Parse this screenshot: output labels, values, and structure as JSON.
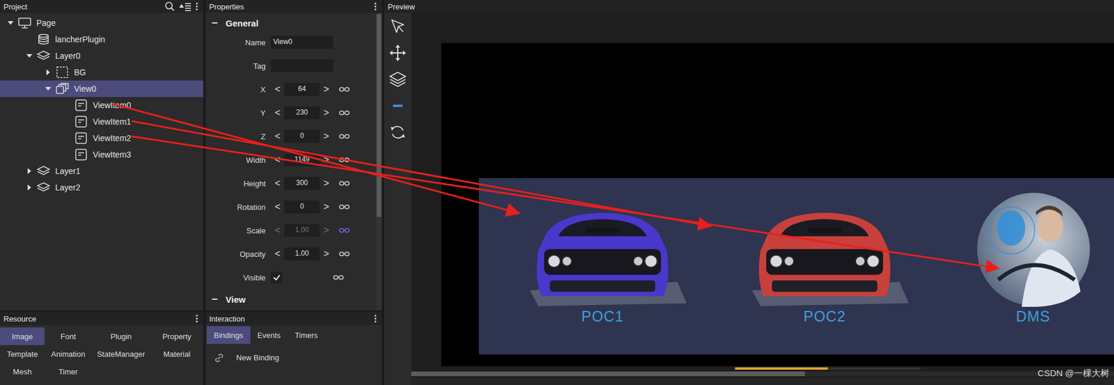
{
  "project": {
    "title": "Project",
    "tree": [
      {
        "label": "Page",
        "kind": "page",
        "expandable": true,
        "expanded": true,
        "selected": false,
        "children": [
          {
            "label": "lancherPlugin",
            "kind": "plugin",
            "expandable": false,
            "expanded": false,
            "selected": false
          },
          {
            "label": "Layer0",
            "kind": "layer",
            "expandable": true,
            "expanded": true,
            "selected": false,
            "children": [
              {
                "label": "BG",
                "kind": "group",
                "expandable": true,
                "expanded": false,
                "selected": false
              },
              {
                "label": "View0",
                "kind": "view",
                "expandable": true,
                "expanded": true,
                "selected": true,
                "children": [
                  {
                    "label": "ViewItem0",
                    "kind": "item",
                    "expandable": false,
                    "expanded": false,
                    "selected": false
                  },
                  {
                    "label": "ViewItem1",
                    "kind": "item",
                    "expandable": false,
                    "expanded": false,
                    "selected": false
                  },
                  {
                    "label": "ViewItem2",
                    "kind": "item",
                    "expandable": false,
                    "expanded": false,
                    "selected": false
                  },
                  {
                    "label": "ViewItem3",
                    "kind": "item",
                    "expandable": false,
                    "expanded": false,
                    "selected": false
                  }
                ]
              }
            ]
          },
          {
            "label": "Layer1",
            "kind": "layer",
            "expandable": true,
            "expanded": false,
            "selected": false
          },
          {
            "label": "Layer2",
            "kind": "layer",
            "expandable": true,
            "expanded": false,
            "selected": false
          }
        ]
      }
    ]
  },
  "resource": {
    "title": "Resource",
    "tabs": [
      {
        "label": "Image",
        "selected": true
      },
      {
        "label": "Font",
        "selected": false
      },
      {
        "label": "Plugin",
        "selected": false
      },
      {
        "label": "Property",
        "selected": false
      },
      {
        "label": "Template",
        "selected": false
      },
      {
        "label": "Animation",
        "selected": false
      },
      {
        "label": "StateManager",
        "selected": false
      },
      {
        "label": "Material",
        "selected": false
      },
      {
        "label": "Mesh",
        "selected": false
      },
      {
        "label": "Timer",
        "selected": false
      }
    ]
  },
  "properties": {
    "title": "Properties",
    "decrement": "<",
    "increment": ">",
    "sections": [
      {
        "title": "General",
        "toggle": "−",
        "expanded": true,
        "fields": [
          {
            "label": "Name",
            "kind": "text",
            "value": "View0"
          },
          {
            "label": "Tag",
            "kind": "text",
            "value": ""
          },
          {
            "label": "X",
            "kind": "number",
            "value": "64",
            "disabled": false,
            "linked": false
          },
          {
            "label": "Y",
            "kind": "number",
            "value": "230",
            "disabled": false,
            "linked": false
          },
          {
            "label": "Z",
            "kind": "number",
            "value": "0",
            "disabled": false,
            "linked": false
          },
          {
            "label": "Width",
            "kind": "number",
            "value": "1149",
            "disabled": false,
            "linked": false
          },
          {
            "label": "Height",
            "kind": "number",
            "value": "300",
            "disabled": false,
            "linked": false
          },
          {
            "label": "Rotation",
            "kind": "number",
            "value": "0",
            "disabled": false,
            "linked": false
          },
          {
            "label": "Scale",
            "kind": "number",
            "value": "1.00",
            "disabled": true,
            "linked": true
          },
          {
            "label": "Opacity",
            "kind": "number",
            "value": "1.00",
            "disabled": false,
            "linked": false
          },
          {
            "label": "Visible",
            "kind": "check",
            "checked": true,
            "linked": false
          }
        ]
      },
      {
        "title": "View",
        "toggle": "−",
        "expanded": true,
        "fields": []
      }
    ]
  },
  "interaction": {
    "title": "Interaction",
    "tabs": [
      {
        "label": "Bindings",
        "selected": true
      },
      {
        "label": "Events",
        "selected": false
      },
      {
        "label": "Timers",
        "selected": false
      }
    ],
    "actions": [
      "New Binding"
    ]
  },
  "preview": {
    "title": "Preview",
    "tools": [
      {
        "kind": "select",
        "selected": false
      },
      {
        "kind": "move",
        "selected": false
      },
      {
        "kind": "layers",
        "selected": false
      },
      {
        "kind": "ruler",
        "selected": true
      },
      {
        "kind": "refresh",
        "selected": false
      }
    ],
    "view_items": [
      {
        "label": "POC1",
        "kind": "car",
        "color": "#4a38cc"
      },
      {
        "label": "POC2",
        "kind": "car",
        "color": "#c8403c"
      },
      {
        "label": "DMS",
        "kind": "portrait"
      }
    ],
    "timeline": {
      "level": 0.5
    },
    "scrollbar": {
      "level": 0.56
    }
  },
  "watermark": "CSDN @一棵大树"
}
